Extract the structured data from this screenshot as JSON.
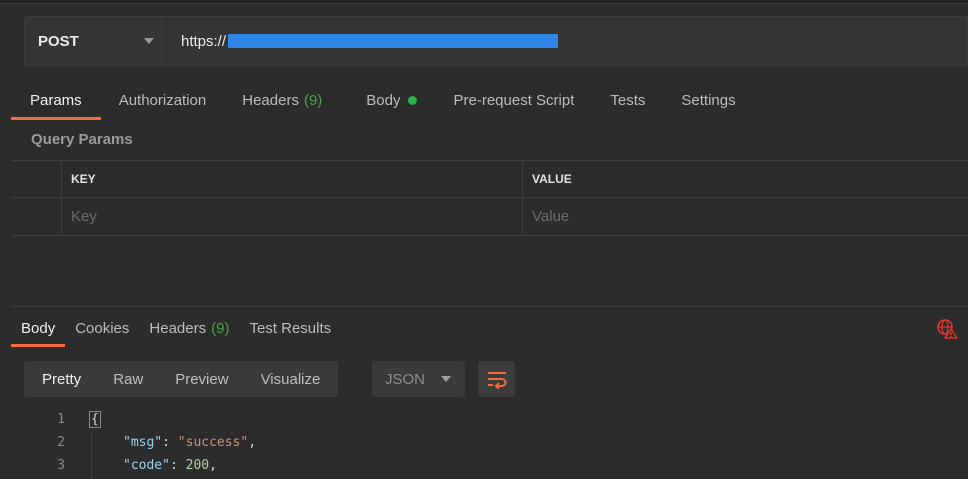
{
  "request": {
    "method": "POST",
    "url_prefix": "https://"
  },
  "request_tabs": [
    {
      "label": "Params",
      "active": true
    },
    {
      "label": "Authorization"
    },
    {
      "label": "Headers",
      "count": "(9)"
    },
    {
      "label": "Body",
      "has_dot": true
    },
    {
      "label": "Pre-request Script"
    },
    {
      "label": "Tests"
    },
    {
      "label": "Settings"
    }
  ],
  "query_params": {
    "title": "Query Params",
    "columns": {
      "key": "KEY",
      "value": "VALUE"
    },
    "placeholders": {
      "key": "Key",
      "value": "Value"
    }
  },
  "response_tabs": [
    {
      "label": "Body",
      "active": true
    },
    {
      "label": "Cookies"
    },
    {
      "label": "Headers",
      "count": "(9)"
    },
    {
      "label": "Test Results"
    }
  ],
  "response_toolbar": {
    "formats": [
      "Pretty",
      "Raw",
      "Preview",
      "Visualize"
    ],
    "active_format": "Pretty",
    "language": "JSON"
  },
  "response_body": {
    "lines": [
      {
        "num": "1",
        "text": "{"
      },
      {
        "num": "2",
        "key": "\"msg\"",
        "value": "\"success\"",
        "type": "string"
      },
      {
        "num": "3",
        "key": "\"code\"",
        "value": "200",
        "type": "number"
      }
    ]
  },
  "colors": {
    "accent": "#f26b3a",
    "count_green": "#47a34e",
    "body_dot": "#26b148",
    "redaction": "#2f86e6"
  },
  "icons": {
    "method_caret": "chevron-down-icon",
    "body_indicator": "dot-icon",
    "network_error": "globe-warning-icon",
    "wrap": "wrap-lines-icon",
    "language_caret": "chevron-down-icon"
  }
}
